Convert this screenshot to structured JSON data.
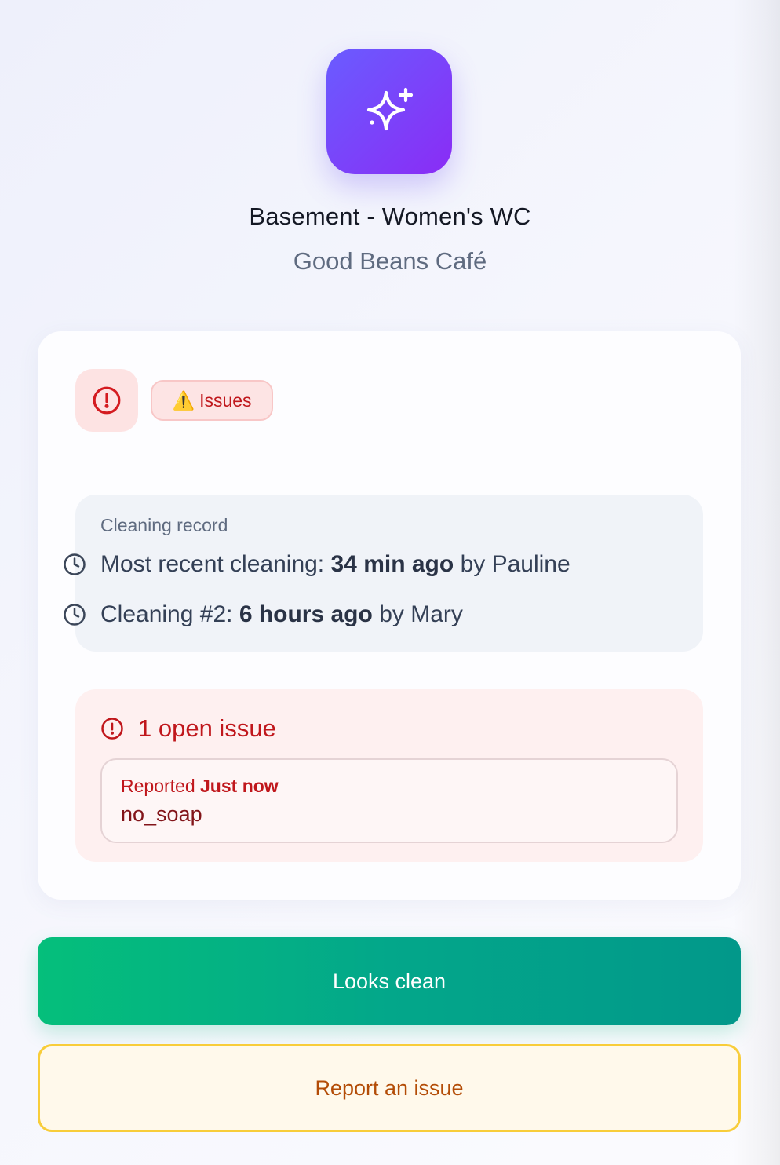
{
  "header": {
    "icon": "sparkles-icon",
    "location_title": "Basement - Women's WC",
    "business_name": "Good Beans Café"
  },
  "status": {
    "icon": "alert-circle-icon",
    "badge_icon": "warning-icon",
    "badge_glyph": "⚠️",
    "badge_label": "Issues"
  },
  "cleaning_record": {
    "label": "Cleaning record",
    "entries": [
      {
        "prefix": "Most recent cleaning:",
        "time": "34 min ago",
        "by": "by",
        "cleaner": "Pauline"
      },
      {
        "prefix": "Cleaning #2:",
        "time": "6 hours ago",
        "by": "by",
        "cleaner": "Mary"
      }
    ]
  },
  "issues": {
    "heading": "1 open issue",
    "items": [
      {
        "reported_prefix": "Reported",
        "reported_time": "Just now",
        "description": "no_soap"
      }
    ]
  },
  "actions": {
    "clean_label": "Looks clean",
    "report_label": "Report an issue"
  },
  "colors": {
    "brand_gradient_start": "#6a5cff",
    "brand_gradient_end": "#8a2cf5",
    "danger": "#c0171c",
    "success_start": "#05bf7b",
    "success_end": "#02988a",
    "warning_border": "#f8cd3a",
    "warning_text": "#b34c06"
  }
}
